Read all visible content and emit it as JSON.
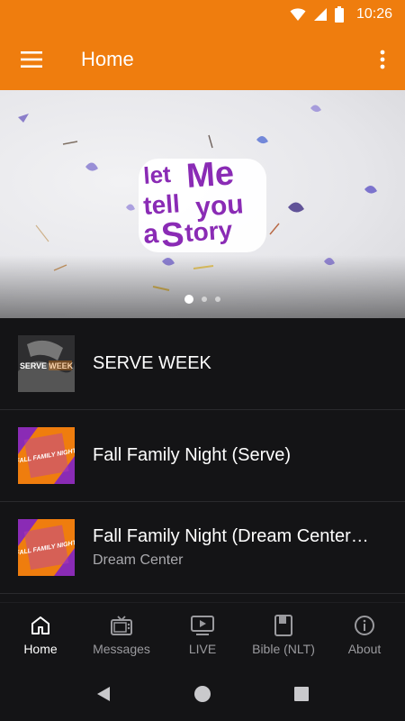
{
  "status_bar": {
    "time": "10:26"
  },
  "app_bar": {
    "title": "Home"
  },
  "hero": {
    "logo_words": [
      "let",
      "Me",
      "tell",
      "you",
      "a",
      "Story"
    ],
    "slide_count": 3,
    "active_slide": 1
  },
  "list": [
    {
      "title": "SERVE WEEK",
      "subtitle": "",
      "thumb": "serve",
      "thumb_text": "SERVE WEEK"
    },
    {
      "title": "Fall Family Night (Serve)",
      "subtitle": "",
      "thumb": "fall",
      "thumb_text": "FALL FAMILY NIGHT"
    },
    {
      "title": "Fall Family Night (Dream Center…",
      "subtitle": "Dream Center",
      "thumb": "fall",
      "thumb_text": "FALL FAMILY NIGHT"
    }
  ],
  "bottom_nav": [
    {
      "label": "Home",
      "icon": "home-icon",
      "active": true
    },
    {
      "label": "Messages",
      "icon": "tv-icon",
      "active": false
    },
    {
      "label": "LIVE",
      "icon": "live-icon",
      "active": false
    },
    {
      "label": "Bible (NLT)",
      "icon": "book-icon",
      "active": false
    },
    {
      "label": "About",
      "icon": "info-icon",
      "active": false
    }
  ],
  "colors": {
    "brand": "#ef7d0e",
    "background": "#141416",
    "logo_purple": "#8a2bb5"
  }
}
